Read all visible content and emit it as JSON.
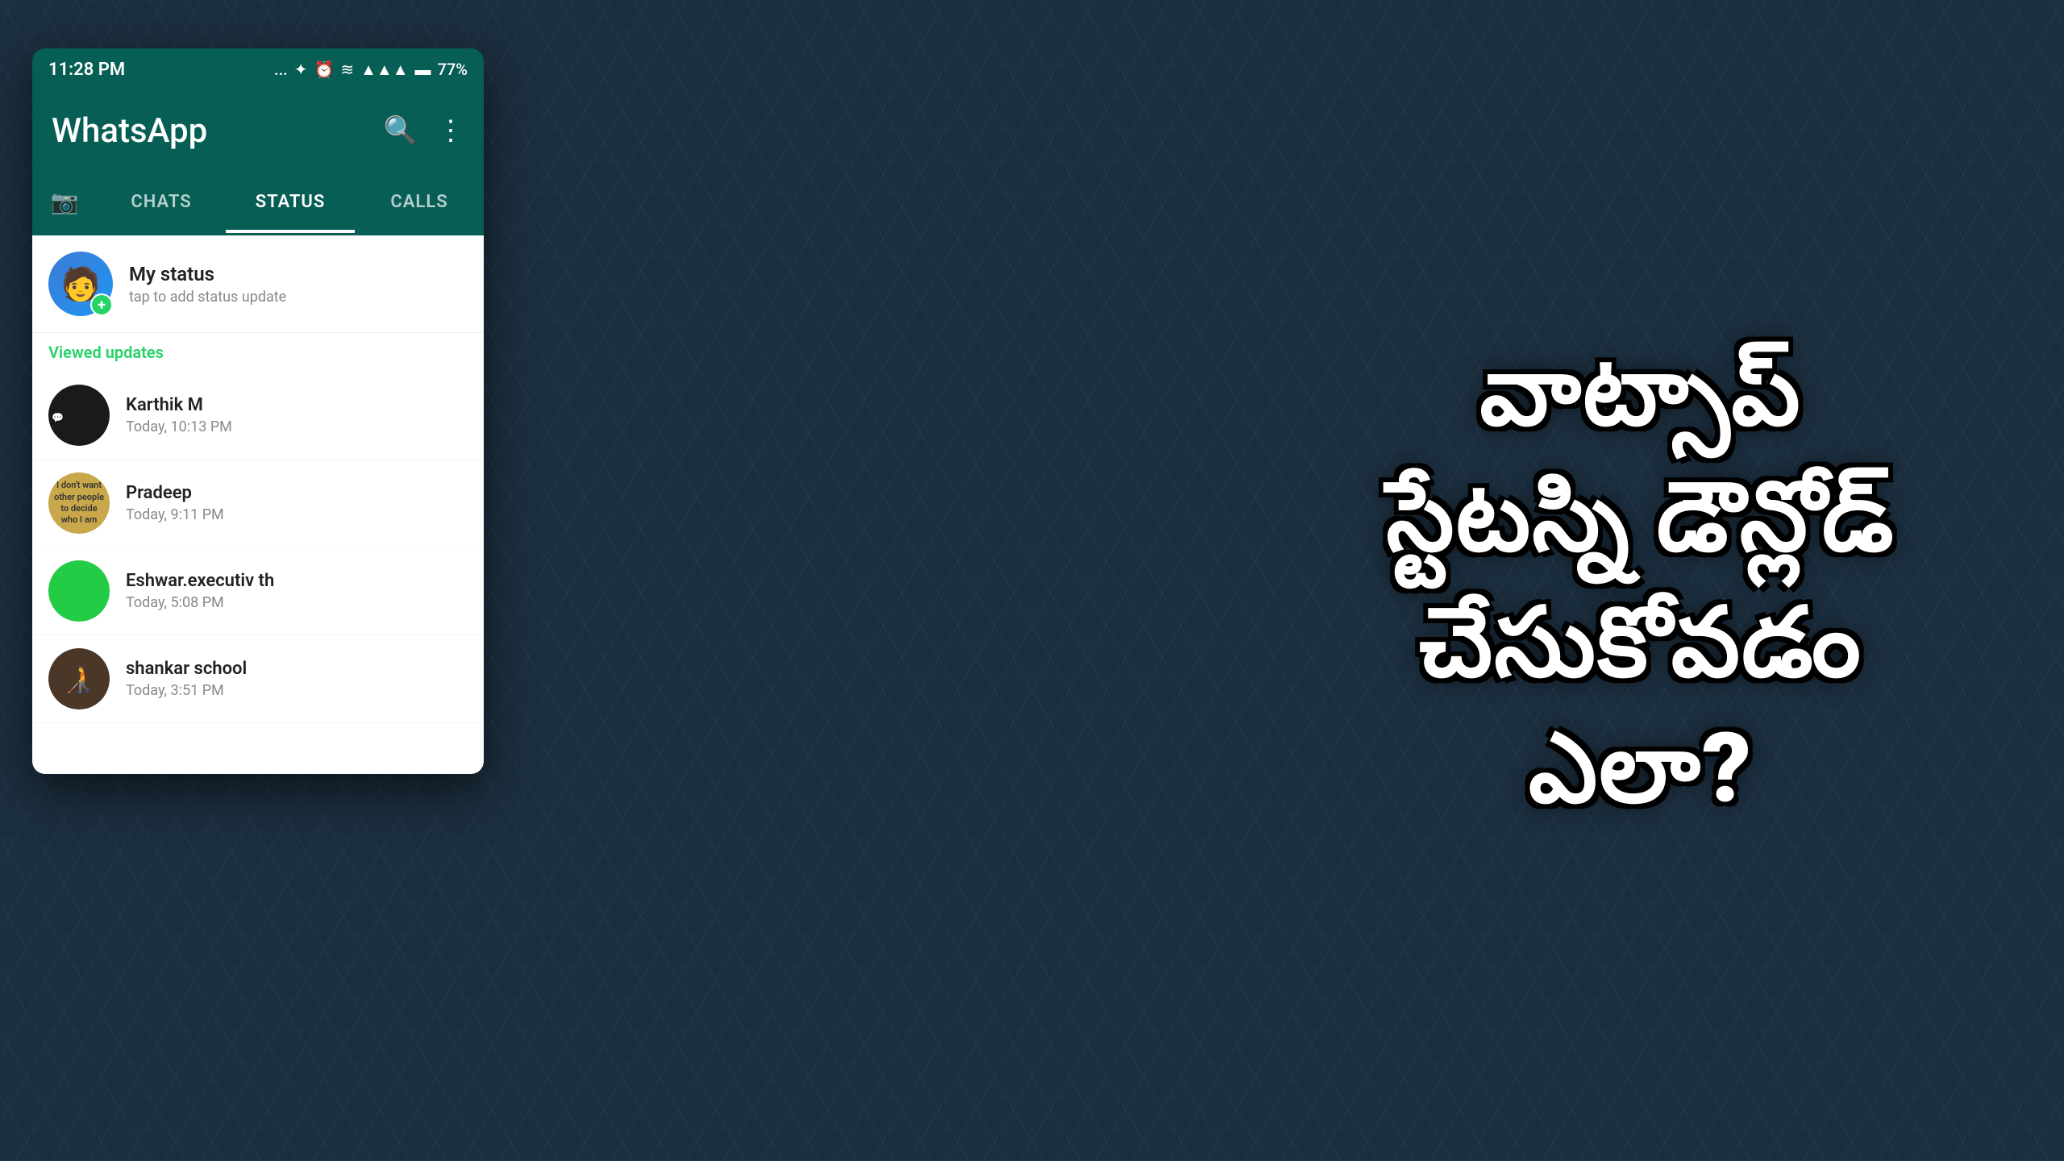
{
  "background": {
    "color": "#1c2f3f"
  },
  "telugu_text": {
    "line1": "వాట్సాప్",
    "line2": "స్టేటస్ని డౌన్లోడ్",
    "line3": "చేసుకోవడం ఎలా?"
  },
  "status_bar": {
    "time": "11:28 PM",
    "indicators": "... ✦ ⏰ ✦ ▲ ▲▲▲ 🔋 77%",
    "battery": "77%"
  },
  "header": {
    "title": "WhatsApp",
    "search_label": "Search",
    "menu_label": "More options"
  },
  "tabs": [
    {
      "id": "camera",
      "label": "📷",
      "type": "icon"
    },
    {
      "id": "chats",
      "label": "CHATS",
      "active": false
    },
    {
      "id": "status",
      "label": "STATUS",
      "active": true
    },
    {
      "id": "calls",
      "label": "CALLS",
      "active": false
    }
  ],
  "my_status": {
    "title": "My status",
    "subtitle": "tap to add status update"
  },
  "viewed_updates": {
    "label": "Viewed updates"
  },
  "contacts": [
    {
      "name": "Karthik M",
      "time": "Today, 10:13 PM",
      "avatar_color": "#2c2c2c",
      "avatar_type": "dark"
    },
    {
      "name": "Pradeep",
      "time": "Today, 9:11 PM",
      "avatar_color": "#c8a84b",
      "avatar_type": "quote"
    },
    {
      "name": "Eshwar.executiv th",
      "time": "Today, 5:08 PM",
      "avatar_color": "#22cc44",
      "avatar_type": "green"
    },
    {
      "name": "shankar school",
      "time": "Today, 3:51 PM",
      "avatar_color": "#4a3728",
      "avatar_type": "person"
    }
  ]
}
